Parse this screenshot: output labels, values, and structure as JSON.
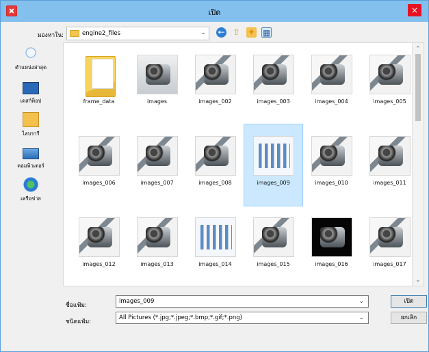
{
  "window": {
    "title": "เปิด",
    "close_symbol": "×"
  },
  "lookin": {
    "label": "มองหาใน:",
    "value": "engine2_files"
  },
  "toolbar": {
    "back_icon": "arrow-left-icon",
    "up_icon": "folder-up-icon",
    "new_folder_icon": "new-folder-icon",
    "views_icon": "view-menu-icon"
  },
  "places": [
    {
      "label": "ตำแหน่งล่าสุด",
      "icon": "recent-places-icon"
    },
    {
      "label": "เดสก์ท็อป",
      "icon": "desktop-icon"
    },
    {
      "label": "ไลบรารี",
      "icon": "libraries-icon"
    },
    {
      "label": "คอมพิวเตอร์",
      "icon": "computer-icon"
    },
    {
      "label": "เครือข่าย",
      "icon": "network-icon"
    }
  ],
  "files": [
    {
      "name": "frame_data",
      "type": "folder"
    },
    {
      "name": "images",
      "type": "car"
    },
    {
      "name": "images_002",
      "type": "engine"
    },
    {
      "name": "images_003",
      "type": "engine"
    },
    {
      "name": "images_004",
      "type": "engine"
    },
    {
      "name": "images_005",
      "type": "engine"
    },
    {
      "name": "images_006",
      "type": "engine"
    },
    {
      "name": "images_007",
      "type": "engine"
    },
    {
      "name": "images_008",
      "type": "engine"
    },
    {
      "name": "images_009",
      "type": "diagram",
      "selected": true
    },
    {
      "name": "images_010",
      "type": "engine"
    },
    {
      "name": "images_011",
      "type": "engine"
    },
    {
      "name": "images_012",
      "type": "engine"
    },
    {
      "name": "images_013",
      "type": "engine"
    },
    {
      "name": "images_014",
      "type": "diagram"
    },
    {
      "name": "images_015",
      "type": "engine"
    },
    {
      "name": "images_016",
      "type": "dark"
    },
    {
      "name": "images_017",
      "type": "engine"
    }
  ],
  "file_name": {
    "label": "ชื่อแฟ้ม:",
    "value": "images_009"
  },
  "file_type": {
    "label": "ชนิดแฟ้ม:",
    "value": "All Pictures (*.jpg;*.jpeg;*.bmp;*.gif;*.png)"
  },
  "buttons": {
    "open": "เปิด",
    "cancel": "ยกเลิก"
  }
}
